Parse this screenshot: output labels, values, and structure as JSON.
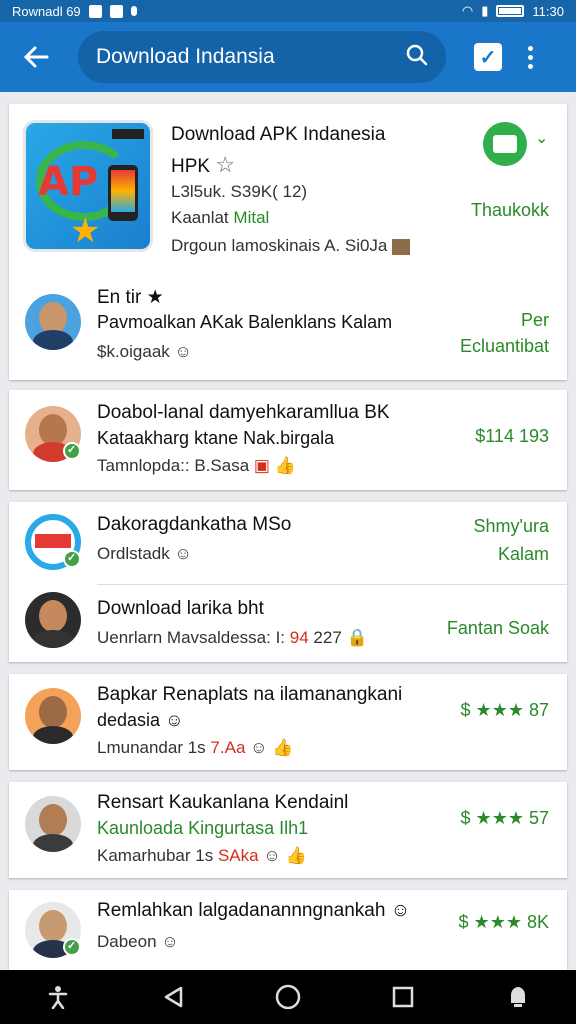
{
  "status": {
    "left_text": "Rownadl 69",
    "time": "11:30"
  },
  "appbar": {
    "search_text": "Download Indansia"
  },
  "app_card": {
    "title": "Download APK Indanesia",
    "title2": "HPK",
    "meta": "L3l5uk. S39K( 12)",
    "category_prefix": "Kaanlat",
    "category": "Mital",
    "developer": "Drgoun lamoskinais A. Si0Ja",
    "right_label": "Thaukokk",
    "logo_text": "AP"
  },
  "reviews": [
    {
      "name": "En tir",
      "text": "Pavmoalkan AKak Balenklans Kalam",
      "meta": "$k.oigaak",
      "right": [
        "Per",
        "Ecluantibat"
      ]
    },
    {
      "name": "Doabol-lanal damyehkaramllua BK",
      "text": "Kataakharg ktane Nak.birgala",
      "meta": "Tamnlopda:: B.Sasa",
      "right": [
        "$114 193"
      ]
    },
    {
      "name": "Dakoragdankatha MSo",
      "text": "",
      "meta": "Ordlstadk",
      "right": [
        "Shmy'ura",
        "Kalam"
      ]
    },
    {
      "name": "Download larika bht",
      "text": "",
      "meta": "Uenrlarn Mavsaldessa: I:",
      "meta_red": "94",
      "meta_tail": "227",
      "right": [
        "Fantan Soak"
      ]
    },
    {
      "name": "Bapkar Renaplats na ilamanangkani",
      "text": "dedasia",
      "meta": "Lmunandar 1s",
      "meta_red": "7.Aa",
      "right": [
        "$ ★★★ 87"
      ]
    },
    {
      "name": "Rensart Kaukanlana Kendainl",
      "text": "Kaunloada Kingurtasa Ilh1",
      "meta": "Kamarhubar 1s",
      "meta_red": "SAka",
      "right": [
        "$ ★★★ 57"
      ]
    },
    {
      "name": "Remlahkan lalgadanannngnankah",
      "text": "",
      "meta": "Dabeon",
      "right": [
        "$ ★★★ 8K"
      ]
    }
  ]
}
